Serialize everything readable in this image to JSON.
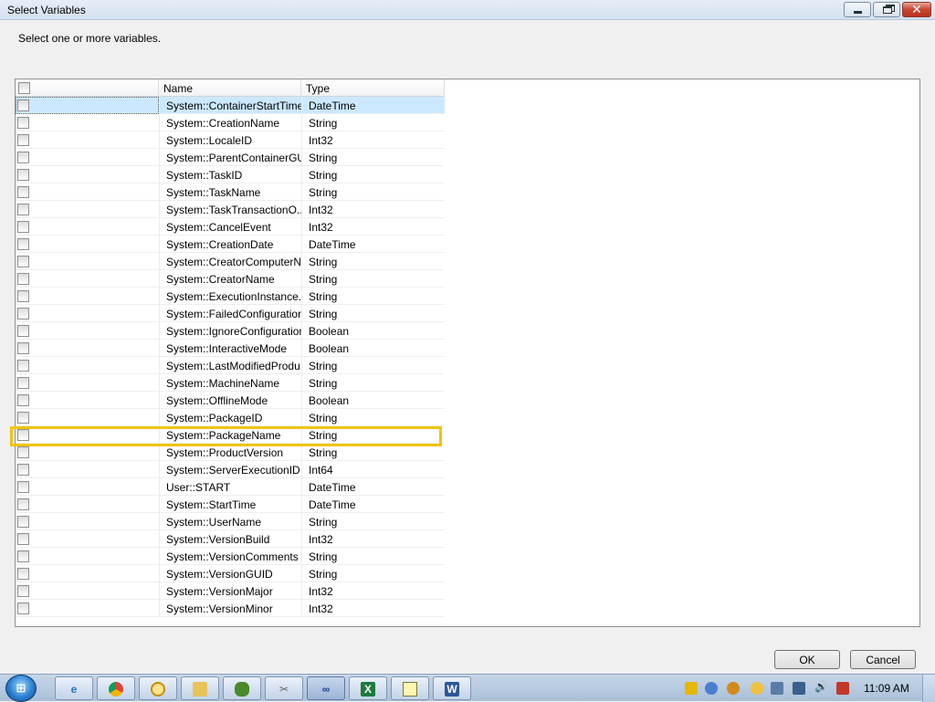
{
  "window": {
    "title": "Select Variables",
    "controls": {
      "minimize": "–",
      "maximize": "□",
      "close": "✕"
    }
  },
  "instruction": "Select one or more variables.",
  "table": {
    "columns": [
      "",
      "Name",
      "Type"
    ],
    "selected_row_index": 0,
    "highlighted_row_index": 19,
    "rows": [
      {
        "name": "System::ContainerStartTime",
        "type": "DateTime",
        "checked": false
      },
      {
        "name": "System::CreationName",
        "type": "String",
        "checked": false
      },
      {
        "name": "System::LocaleID",
        "type": "Int32",
        "checked": false
      },
      {
        "name": "System::ParentContainerGU...",
        "type": "String",
        "checked": false
      },
      {
        "name": "System::TaskID",
        "type": "String",
        "checked": false
      },
      {
        "name": "System::TaskName",
        "type": "String",
        "checked": false
      },
      {
        "name": "System::TaskTransactionO...",
        "type": "Int32",
        "checked": false
      },
      {
        "name": "System::CancelEvent",
        "type": "Int32",
        "checked": false
      },
      {
        "name": "System::CreationDate",
        "type": "DateTime",
        "checked": false
      },
      {
        "name": "System::CreatorComputerN...",
        "type": "String",
        "checked": false
      },
      {
        "name": "System::CreatorName",
        "type": "String",
        "checked": false
      },
      {
        "name": "System::ExecutionInstance...",
        "type": "String",
        "checked": false
      },
      {
        "name": "System::FailedConfigurations",
        "type": "String",
        "checked": false
      },
      {
        "name": "System::IgnoreConfiguration...",
        "type": "Boolean",
        "checked": false
      },
      {
        "name": "System::InteractiveMode",
        "type": "Boolean",
        "checked": false
      },
      {
        "name": "System::LastModifiedProdu...",
        "type": "String",
        "checked": false
      },
      {
        "name": "System::MachineName",
        "type": "String",
        "checked": false
      },
      {
        "name": "System::OfflineMode",
        "type": "Boolean",
        "checked": false
      },
      {
        "name": "System::PackageID",
        "type": "String",
        "checked": false
      },
      {
        "name": "System::PackageName",
        "type": "String",
        "checked": false
      },
      {
        "name": "System::ProductVersion",
        "type": "String",
        "checked": false
      },
      {
        "name": "System::ServerExecutionID",
        "type": "Int64",
        "checked": false
      },
      {
        "name": "User::START",
        "type": "DateTime",
        "checked": false
      },
      {
        "name": "System::StartTime",
        "type": "DateTime",
        "checked": false
      },
      {
        "name": "System::UserName",
        "type": "String",
        "checked": false
      },
      {
        "name": "System::VersionBuild",
        "type": "Int32",
        "checked": false
      },
      {
        "name": "System::VersionComments",
        "type": "String",
        "checked": false
      },
      {
        "name": "System::VersionGUID",
        "type": "String",
        "checked": false
      },
      {
        "name": "System::VersionMajor",
        "type": "Int32",
        "checked": false
      },
      {
        "name": "System::VersionMinor",
        "type": "Int32",
        "checked": false
      }
    ]
  },
  "buttons": {
    "ok": "OK",
    "cancel": "Cancel"
  },
  "taskbar": {
    "apps": [
      {
        "icon": "internet-explorer-icon",
        "glyph": "e",
        "cls": "ico-ie"
      },
      {
        "icon": "chrome-icon",
        "glyph": "",
        "cls": "ico-chrome"
      },
      {
        "icon": "clock-app-icon",
        "glyph": "",
        "cls": "ico-clock"
      },
      {
        "icon": "file-explorer-icon",
        "glyph": "",
        "cls": "ico-folder"
      },
      {
        "icon": "frog-app-icon",
        "glyph": "",
        "cls": "ico-frog"
      },
      {
        "icon": "tools-icon",
        "glyph": "✂",
        "cls": "ico-tools"
      },
      {
        "icon": "visual-studio-icon",
        "glyph": "∞",
        "cls": "ico-infinity",
        "active": true
      },
      {
        "icon": "excel-icon",
        "glyph": "X",
        "cls": "ico-excel"
      },
      {
        "icon": "notepad-icon",
        "glyph": "",
        "cls": "ico-notepad"
      },
      {
        "icon": "word-icon",
        "glyph": "W",
        "cls": "ico-word"
      }
    ],
    "clock": "11:09 AM"
  }
}
